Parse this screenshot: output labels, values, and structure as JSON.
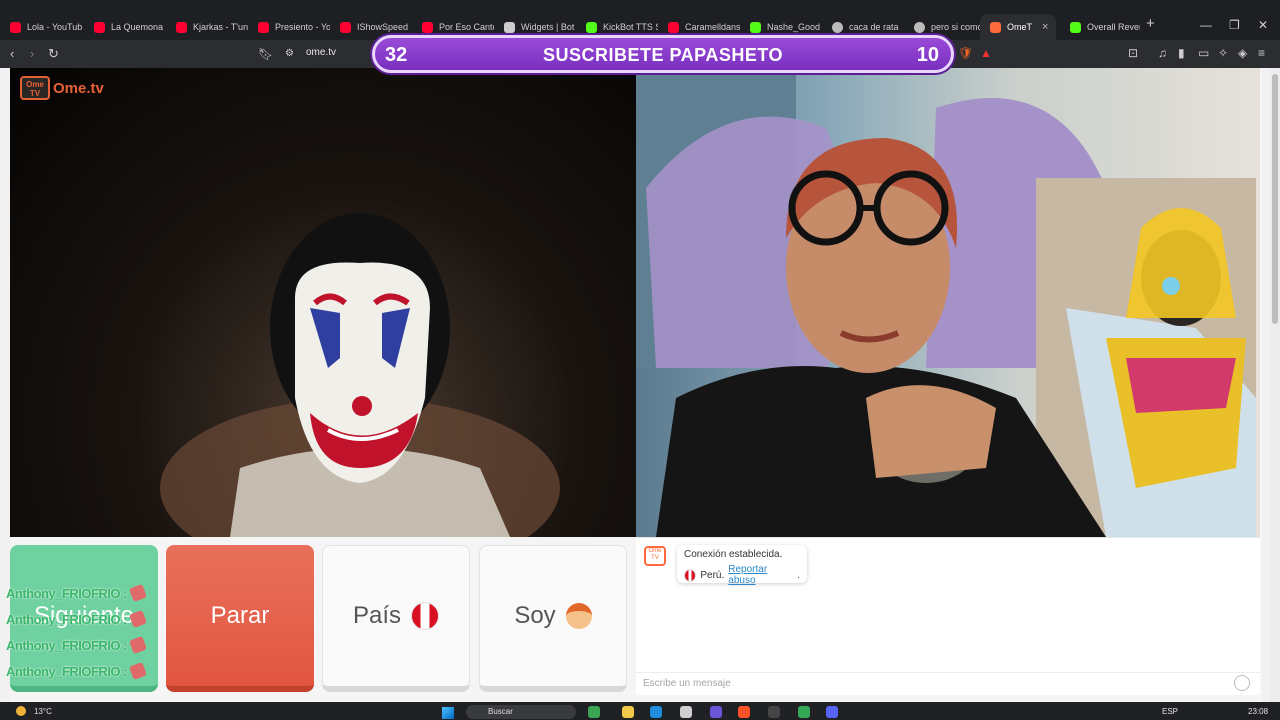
{
  "browser": {
    "tabs": [
      {
        "label": "Lola - YouTub",
        "fav": "#ff0033"
      },
      {
        "label": "La Quemona",
        "fav": "#ff0033"
      },
      {
        "label": "Kjarkas - T'un",
        "fav": "#ff0033"
      },
      {
        "label": "Presiento - Yo",
        "fav": "#ff0033"
      },
      {
        "label": "IShowSpeed",
        "fav": "#ff0033"
      },
      {
        "label": "Por Eso Canto",
        "fav": "#ff0033"
      },
      {
        "label": "Widgets | Bot",
        "fav": "#cccccc"
      },
      {
        "label": "KickBot TTS S",
        "fav": "#53fc18"
      },
      {
        "label": "Caramelldans",
        "fav": "#ff0033"
      },
      {
        "label": "Nashe_Good",
        "fav": "#53fc18"
      },
      {
        "label": "caca de rata",
        "fav": "#bbbbbb"
      },
      {
        "label": "pero si como",
        "fav": "#bbbbbb"
      },
      {
        "label": "OmeT",
        "fav": "#ff6a3d"
      },
      {
        "label": "Overall Rever",
        "fav": "#53fc18"
      }
    ],
    "url": "ome.tv",
    "new_tab": "+",
    "close_tab": "×"
  },
  "banner": {
    "left_number": "32",
    "title": "SUSCRIBETE PAPASHETO",
    "right_number": "10"
  },
  "site": {
    "logo_box": "Ome TV",
    "logo_text": "Ome.tv"
  },
  "buttons": {
    "next": "Siguiente",
    "stop": "Parar",
    "country": "País",
    "gender": "Soy"
  },
  "chat_overlay": [
    "Anthony_FRIOFRIO :",
    "Anthony_FRIOFRIO :",
    "Anthony_FRIOFRIO :",
    "Anthony_FRIOFRIO :"
  ],
  "chat": {
    "avatar": "Ome TV",
    "status_line": "Conexión establecida.",
    "country": "Perú.",
    "report_link": "Reportar abuso",
    "report_suffix": ".",
    "input_placeholder": "Escribe un mensaje"
  },
  "taskbar": {
    "weather": "13°C",
    "search": "Buscar",
    "lang": "ESP",
    "time": "23:08"
  }
}
